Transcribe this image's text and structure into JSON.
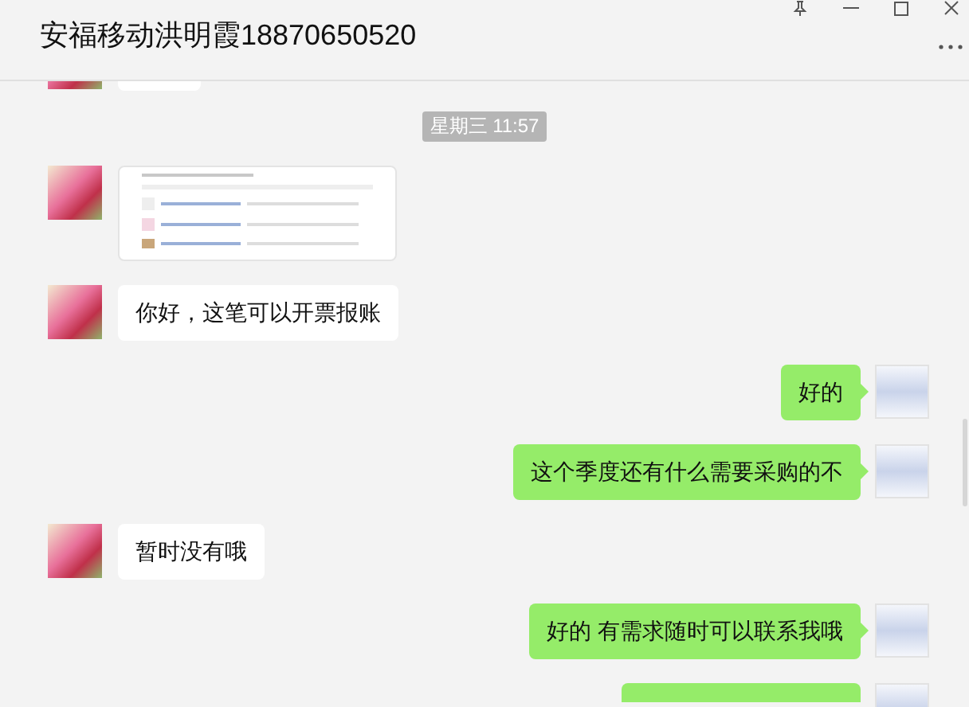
{
  "window": {
    "title": "安福移动洪明霞18870650520"
  },
  "messages": [
    {
      "kind": "partial",
      "from_me": false
    },
    {
      "kind": "time",
      "text": "星期三 11:57"
    },
    {
      "kind": "image",
      "from_me": false
    },
    {
      "kind": "text",
      "from_me": false,
      "text": "你好，这笔可以开票报账"
    },
    {
      "kind": "text",
      "from_me": true,
      "text": "好的"
    },
    {
      "kind": "text",
      "from_me": true,
      "text": "这个季度还有什么需要采购的不"
    },
    {
      "kind": "text",
      "from_me": false,
      "text": "暂时没有哦"
    },
    {
      "kind": "text",
      "from_me": true,
      "text": "好的 有需求随时可以联系我哦"
    },
    {
      "kind": "partial",
      "from_me": true
    }
  ]
}
